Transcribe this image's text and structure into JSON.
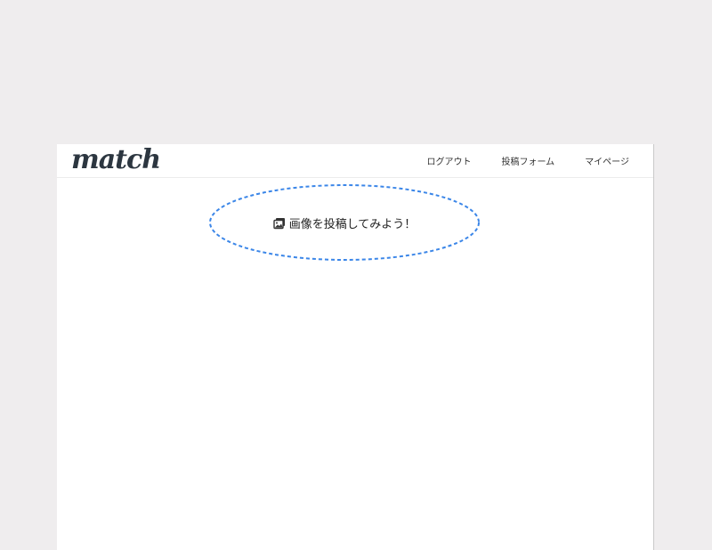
{
  "header": {
    "logo": "match",
    "nav": [
      {
        "label": "ログアウト"
      },
      {
        "label": "投稿フォーム"
      },
      {
        "label": "マイページ"
      }
    ]
  },
  "upload": {
    "label": "画像を投稿してみよう！",
    "icon": "image-icon",
    "border_color": "#3b86e8"
  }
}
